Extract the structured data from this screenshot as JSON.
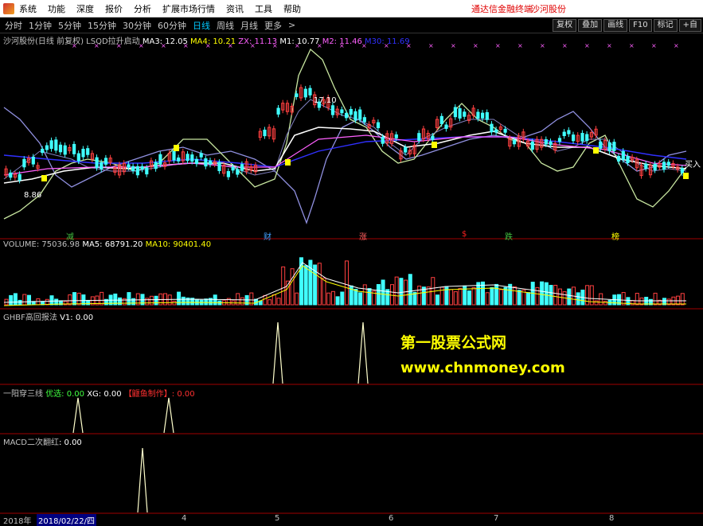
{
  "menubar": {
    "items": [
      "系统",
      "功能",
      "深度",
      "报价",
      "分析",
      "扩展市场行情",
      "资讯",
      "工具",
      "帮助"
    ],
    "promo": "通达信金融终端",
    "stock_name": "沙河股份"
  },
  "toolbar": {
    "periods": [
      "分时",
      "1分钟",
      "5分钟",
      "15分钟",
      "30分钟",
      "60分钟",
      "日线",
      "周线",
      "月线",
      "更多"
    ],
    "active": "日线",
    "more_arrow": ">",
    "right_buttons": [
      "复权",
      "叠加",
      "画线",
      "F10",
      "标记",
      "+自"
    ]
  },
  "main_chart": {
    "title": "沙河股份(日线 前复权) LSQD拉升启动",
    "ma3": "MA3: 12.05",
    "ma4": "MA4: 10.21",
    "zx": "ZX: 11.13",
    "m1": "M1: 10.77",
    "m2": "M2: 11.46",
    "m30": "M30: 11.69",
    "high_label": "17.10",
    "low_label": "8.86",
    "buy_label": "买入",
    "markers": [
      "减",
      "财",
      "涨",
      "$",
      "跌",
      "榜"
    ],
    "colors": {
      "band": "#9090e0",
      "outer": "#c8e6a0",
      "white": "#ffffff",
      "blue": "#3030ff",
      "pink": "#ff60ff",
      "up": "#ff4040",
      "down": "#40ffff",
      "yellow": "#ffff00"
    }
  },
  "volume": {
    "label": "VOLUME: 75036.98",
    "ma5": "MA5: 68791.20",
    "ma10": "MA10: 90401.40"
  },
  "panel1": {
    "title": "GHBF高回报法",
    "v1": "V1: 0.00"
  },
  "panel2": {
    "title": "一阳穿三线",
    "yx": "优选: 0.00",
    "xg": "XG: 0.00",
    "author": "【鼴鱼制作】: 0.00"
  },
  "panel3": {
    "title": "MACD二次翻红",
    "value": ": 0.00"
  },
  "watermark": {
    "line1": "第一股票公式网",
    "line2": "www.chnmoney.com"
  },
  "bottombar": {
    "year": "2018年",
    "date": "2018/02/22/四",
    "months": [
      "4",
      "5",
      "6",
      "7",
      "8"
    ]
  }
}
